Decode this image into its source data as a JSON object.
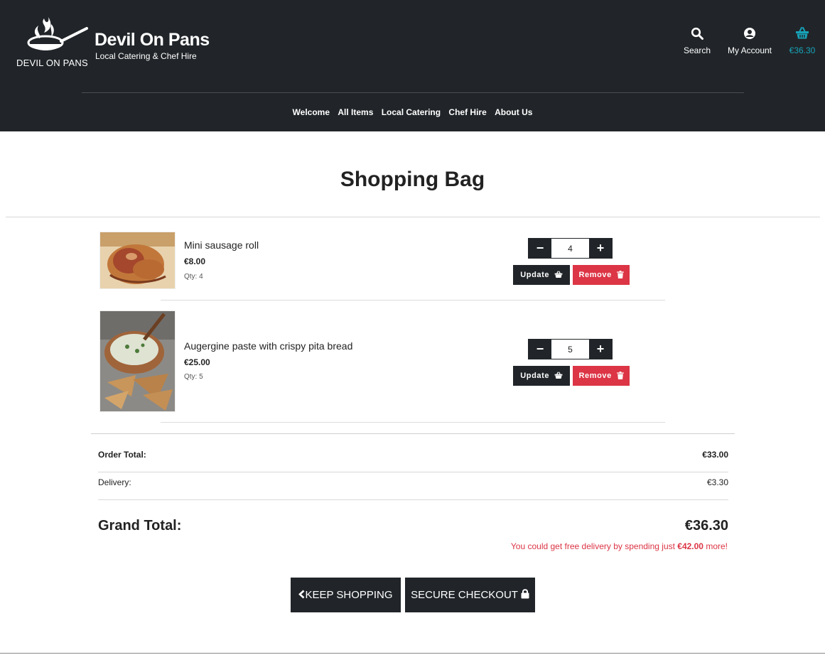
{
  "header": {
    "logo_text": "DEVIL ON PANS",
    "brand_title": "Devil On Pans",
    "brand_subtitle": "Local Catering & Chef Hire",
    "search_label": "Search",
    "account_label": "My Account",
    "bag_total": "€36.30",
    "icons": {
      "search": "search-icon",
      "account": "user-circle-icon",
      "bag": "shopping-basket-icon"
    },
    "bag_color": "#17a2b8"
  },
  "nav": {
    "items": [
      "Welcome",
      "All Items",
      "Local Catering",
      "Chef Hire",
      "About Us"
    ]
  },
  "page": {
    "title": "Shopping Bag"
  },
  "bag": {
    "items": [
      {
        "name": "Mini sausage roll",
        "price": "€8.00",
        "qty_label": "Qty: 4",
        "qty_value": "4"
      },
      {
        "name": "Augergine paste with crispy pita bread",
        "price": "€25.00",
        "qty_label": "Qty: 5",
        "qty_value": "5"
      }
    ],
    "update_label": "Update",
    "remove_label": "Remove",
    "minus_label": "−",
    "plus_label": "+"
  },
  "totals": {
    "order_total_label": "Order Total:",
    "order_total_value": "€33.00",
    "delivery_label": "Delivery:",
    "delivery_value": "€3.30",
    "grand_total_label": "Grand Total:",
    "grand_total_value": "€36.30",
    "free_delivery_prefix": "You could get free delivery by spending just ",
    "free_delivery_amount": "€42.00",
    "free_delivery_suffix": " more!"
  },
  "actions": {
    "keep_shopping": "KEEP SHOPPING",
    "secure_checkout": "SECURE CHECKOUT"
  },
  "colors": {
    "dark": "#212529",
    "danger": "#dc3545",
    "info": "#17a2b8"
  }
}
